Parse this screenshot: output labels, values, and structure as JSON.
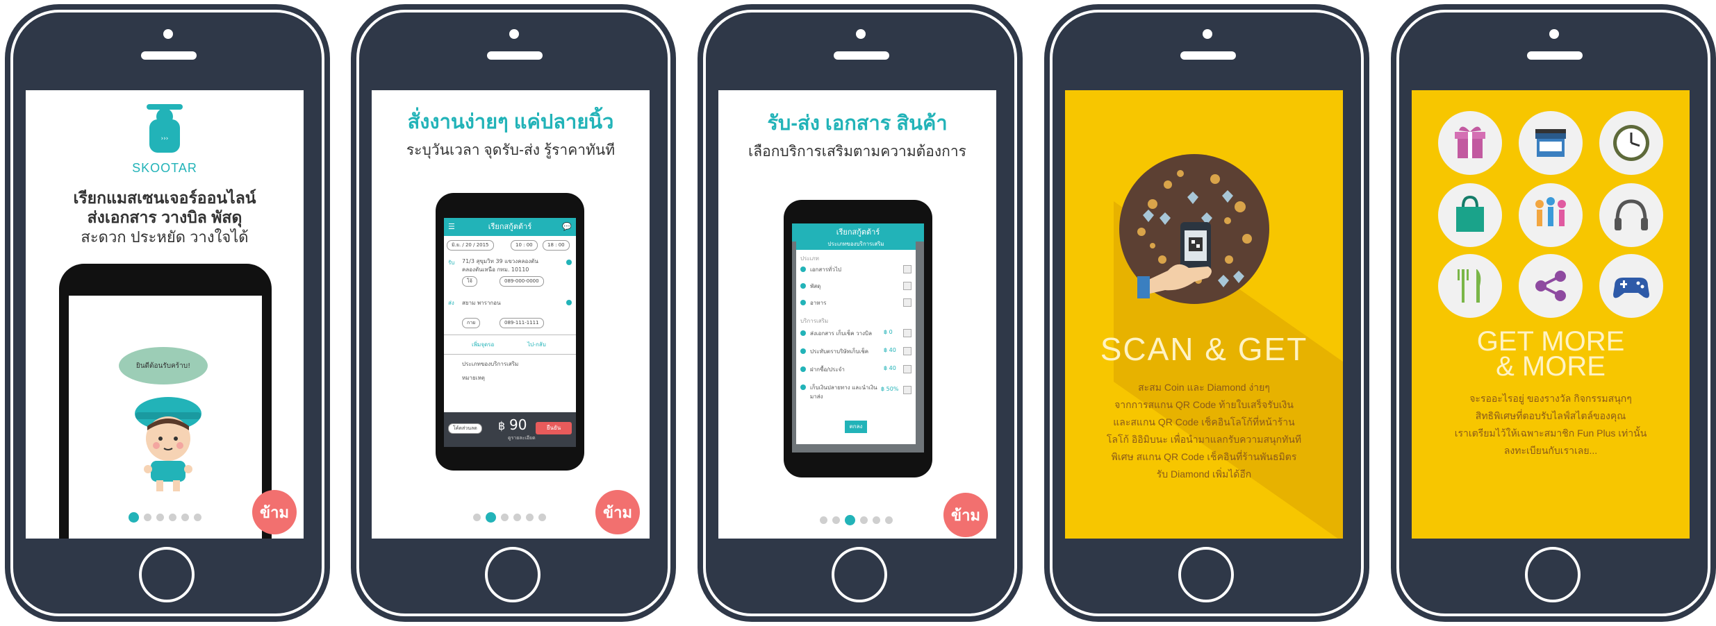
{
  "phone1": {
    "brand": "SKOOTAR",
    "heading_line1": "เรียกแมสเซนเจอร์ออนไลน์",
    "heading_line2": "ส่งเอกสาร วางบิล พัสดุ",
    "heading_line3": "สะดวก ประหยัด วางใจได้",
    "speech": "ยินดีต้อนรับคร้าบ!",
    "skip_label": "ข้าม",
    "page_index": 0,
    "page_count": 6
  },
  "phone2": {
    "heading": "สั่งงานง่ายๆ แค่ปลายนิ้ว",
    "subheading": "ระบุวันเวลา จุดรับ-ส่ง รู้ราคาทันที",
    "app": {
      "title": "เรียกสกู้ตต้าร์",
      "date": "มิ.ย. / 20 / 2015",
      "time_start": "10 : 00",
      "time_end": "18 : 00",
      "pickup_label": "รับ",
      "pickup_address_1": "71/3 สุขุมวิท 39 แขวงคลองตัน",
      "pickup_address_2": "คลองตันเหนือ กทม. 10110",
      "pickup_name": "โจ้",
      "pickup_phone": "089-000-0000",
      "drop_label": "ส่ง",
      "drop_address": "สยาม พารากอน",
      "drop_name": "กาย",
      "drop_phone": "089-111-1111",
      "add_point": "เพิ่มจุดรอ",
      "round_trip": "ไป-กลับ",
      "extra_services": "ประเภทของบริการเสริม",
      "note": "หมายเหตุ",
      "payment": "โค้ดส่วนลด",
      "price_currency": "฿",
      "price": "90",
      "price_note": "ดูรายละเอียด",
      "confirm": "ยืนยัน"
    },
    "skip_label": "ข้าม",
    "page_index": 1,
    "page_count": 6
  },
  "phone3": {
    "heading": "รับ-ส่ง เอกสาร สินค้า",
    "subheading": "เลือกบริการเสริมตามความต้องการ",
    "app": {
      "title": "เรียกสกู้ตต้าร์",
      "dialog_title": "ประเภทของบริการเสริม",
      "section1": "ประเภท",
      "items1": [
        "เอกสารทั่วไป",
        "พัสดุ",
        "อาหาร"
      ],
      "section2": "บริการเสริม",
      "items2": [
        {
          "label": "ส่งเอกสาร เก็บเช็ค วางบิล",
          "price": "฿ 0"
        },
        {
          "label": "ประทับตราบริษัทเก็บเช็ค",
          "price": "฿ 40"
        },
        {
          "label": "ฝากซื้อ/ประจำ",
          "price": "฿ 40"
        },
        {
          "label": "เก็บเงินปลายทาง และนำเงินมาส่ง",
          "price": "฿ 50%"
        }
      ],
      "ok": "ตกลง"
    },
    "skip_label": "ข้าม",
    "page_index": 2,
    "page_count": 6
  },
  "phone4": {
    "title": "SCAN & GET",
    "lines": [
      "สะสม Coin และ Diamond ง่ายๆ",
      "จากการสแกน QR Code ท้ายใบเสร็จรับเงิน",
      "และสแกน QR Code เช็คอินโลโก้ที่หน้าร้าน",
      "โลโก้ อิอิมิบนะ เพื่อนำมาแลกรับความสนุกทันที",
      "พิเศษ สแกน QR Code เช็คอินที่ร้านพันธมิตร",
      "รับ Diamond เพิ่มได้อีก"
    ],
    "bg_color": "#f7c600"
  },
  "phone5": {
    "title_line1": "GET MORE",
    "title_line2": "& MORE",
    "lines": [
      "จะรออะไรอยู่ ของรางวัล กิจกรรมสนุกๆ",
      "สิทธิพิเศษที่ตอบรับไลฟ์สไตล์ของคุณ",
      "เราเตรียมไว้ให้เฉพาะสมาชิก Fun Plus เท่านั้น",
      "ลงทะเบียนกับเราเลย..."
    ],
    "icons": [
      "gift-icon",
      "shop-icon",
      "clock-icon",
      "shopping-bag-icon",
      "people-icon",
      "headphones-icon",
      "fork-knife-icon",
      "share-icon",
      "gamepad-icon"
    ]
  }
}
